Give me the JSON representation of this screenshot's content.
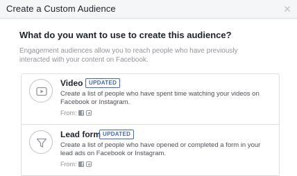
{
  "dialog": {
    "title": "Create a Custom Audience",
    "close_icon": "close-icon"
  },
  "main": {
    "question": "What do you want to use to create this audience?",
    "description": "Engagement audiences allow you to reach people who have previously interacted with your content on Facebook."
  },
  "options": [
    {
      "title": "Video",
      "badge": "UPDATED",
      "description": "Create a list of people who have spent time watching your videos on Facebook or Instagram.",
      "from_label": "From:",
      "icon": "video-play-icon",
      "sources": [
        "facebook-icon",
        "instagram-icon"
      ]
    },
    {
      "title": "Lead form",
      "badge": "UPDATED",
      "description": "Create a list of people who have opened or completed a form in your lead ads on Facebook or Instagram.",
      "from_label": "From:",
      "icon": "funnel-icon",
      "sources": [
        "facebook-icon",
        "instagram-icon"
      ]
    }
  ],
  "colors": {
    "badge": "#4267b2",
    "muted_text": "#90949c",
    "border": "#dddfe2"
  }
}
